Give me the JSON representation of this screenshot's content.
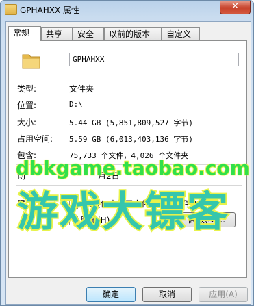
{
  "window": {
    "title": "GPHAHXX 属性",
    "close_glyph": "✕"
  },
  "tabs": [
    "常规",
    "共享",
    "安全",
    "以前的版本",
    "自定义"
  ],
  "general": {
    "name": "GPHAHXX",
    "rows": [
      {
        "label": "类型:",
        "value": "文件夹"
      },
      {
        "label": "位置:",
        "value": "D:\\"
      },
      {
        "label": "大小:",
        "value": "5.44 GB (5,851,809,527 字节)"
      },
      {
        "label": "占用空间:",
        "value": "5.59 GB (6,013,403,136 字节)"
      },
      {
        "label": "包含:",
        "value": "75,733 个文件，4,026 个文件夹"
      }
    ],
    "created_label": "创",
    "created_value": "月2日",
    "attr_label": "属",
    "readonly_label": "只读(仅应用于文件夹中的文件)(R)",
    "hidden_label": "隐藏(H)",
    "advanced_label": "高级(D)..."
  },
  "buttons": {
    "ok": "确定",
    "cancel": "取消",
    "apply": "应用(A)"
  },
  "watermark": {
    "line1": "dbkgame.taobao.com",
    "line2": "游戏大镖客"
  },
  "colors": {
    "watermark_green": "#31e04a",
    "watermark_teal": "#35c6ad",
    "watermark_outline": "#e7f24a"
  }
}
